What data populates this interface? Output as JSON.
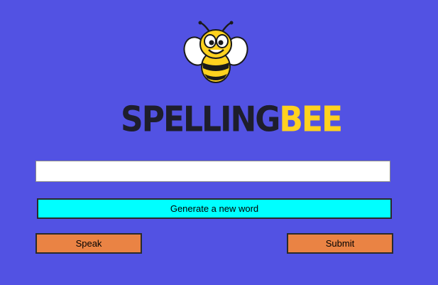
{
  "logo": {
    "part1": "SPELLING",
    "part2": "BEE",
    "icon": "bee-mascot-icon"
  },
  "word_input": {
    "value": "",
    "placeholder": ""
  },
  "buttons": {
    "generate": "Generate a new word",
    "speak": "Speak",
    "submit": "Submit"
  },
  "colors": {
    "background": "#5252e3",
    "generate_button": "#00ffff",
    "action_buttons": "#ea8344",
    "logo_dark": "#1e1e2c",
    "logo_yellow": "#ffd21f"
  }
}
